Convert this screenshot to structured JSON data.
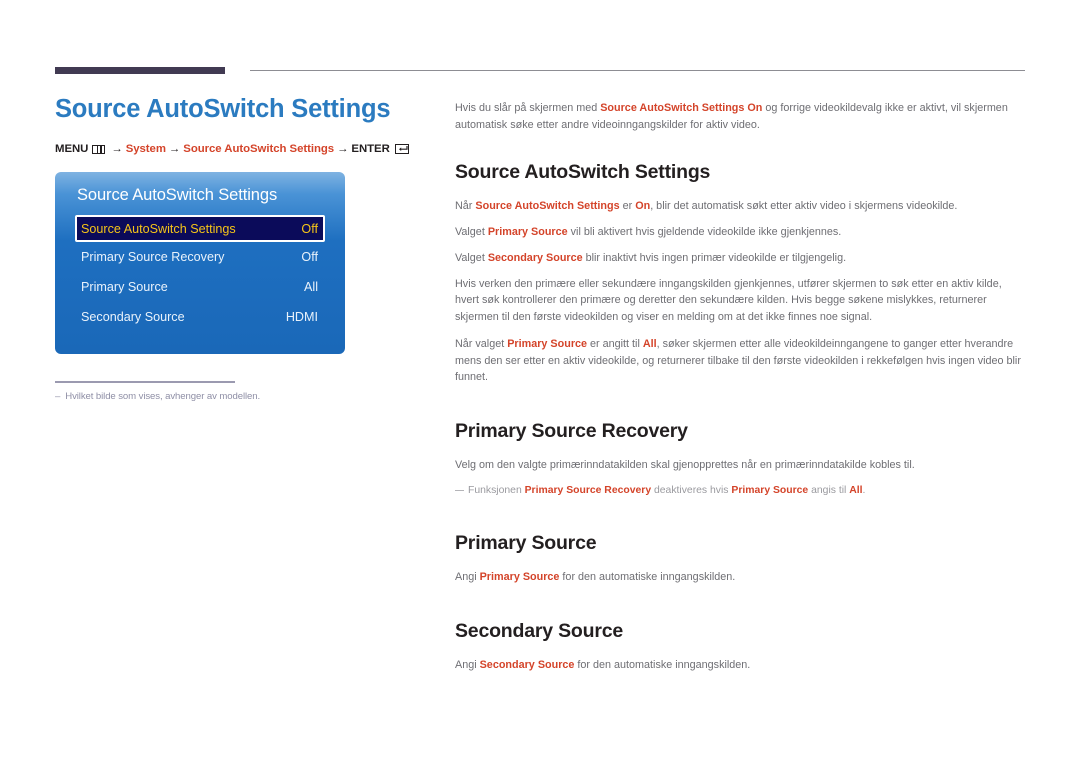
{
  "header": {
    "rule_bar_color": "#413a52",
    "rule_line_color": "#8d8d93"
  },
  "left": {
    "page_title": "Source AutoSwitch Settings",
    "menu_path": {
      "menu_label": "MENU",
      "menu_icon": "menu-grid-icon",
      "arrow": "→",
      "step1": "System",
      "step2": "Source AutoSwitch Settings",
      "enter_label": "ENTER",
      "enter_icon": "enter-return-icon"
    },
    "osd": {
      "title": "Source AutoSwitch Settings",
      "rows": [
        {
          "label": "Source AutoSwitch Settings",
          "value": "Off",
          "selected": true
        },
        {
          "label": "Primary Source Recovery",
          "value": "Off",
          "selected": false
        },
        {
          "label": "Primary Source",
          "value": "All",
          "selected": false
        },
        {
          "label": "Secondary Source",
          "value": "HDMI",
          "selected": false
        }
      ],
      "selected_bg": "#0b0b5a",
      "selected_text": "#f5c518",
      "panel_blue": "#1e6fc0"
    },
    "footnote": {
      "dash": "–",
      "text": "Hvilket bilde som vises, avhenger av modellen."
    }
  },
  "right": {
    "intro": {
      "part1": "Hvis du slår på skjermen med ",
      "hl1": "Source AutoSwitch Settings On",
      "part2": " og forrige videokildevalg ikke er aktivt, vil skjermen automatisk søke etter andre videoinngangskilder for aktiv video."
    },
    "sections": [
      {
        "title": "Source AutoSwitch Settings",
        "paras": [
          {
            "p1": "Når ",
            "h1": "Source AutoSwitch Settings",
            "p2": " er ",
            "h2": "On",
            "p3": ", blir det automatisk søkt etter aktiv video i skjermens videokilde."
          },
          {
            "p1": "Valget ",
            "h1": "Primary Source",
            "p2": " vil bli aktivert hvis gjeldende videokilde ikke gjenkjennes.",
            "h2": "",
            "p3": ""
          },
          {
            "p1": "Valget ",
            "h1": "Secondary Source",
            "p2": " blir inaktivt hvis ingen primær videokilde er tilgjengelig.",
            "h2": "",
            "p3": ""
          },
          {
            "p1": "Hvis verken den primære eller sekundære inngangskilden gjenkjennes, utfører skjermen to søk etter en aktiv kilde, hvert søk kontrollerer den primære og deretter den sekundære kilden. Hvis begge søkene mislykkes, returnerer skjermen til den første videokilden og viser en melding om at det ikke finnes noe signal.",
            "h1": "",
            "p2": "",
            "h2": "",
            "p3": ""
          },
          {
            "p1": "Når valget ",
            "h1": "Primary Source",
            "p2": " er angitt til ",
            "h2": "All",
            "p3": ", søker skjermen etter alle videokildeinngangene to ganger etter hverandre mens den ser etter en aktiv videokilde, og returnerer tilbake til den første videokilden i rekkefølgen hvis ingen video blir funnet."
          }
        ],
        "note": null
      },
      {
        "title": "Primary Source Recovery",
        "paras": [
          {
            "p1": "Velg om den valgte primærinndatakilden skal gjenopprettes når en primærinndatakilde kobles til.",
            "h1": "",
            "p2": "",
            "h2": "",
            "p3": ""
          }
        ],
        "note": {
          "n1": "Funksjonen ",
          "h1": "Primary Source Recovery",
          "n2": " deaktiveres hvis ",
          "h2": "Primary Source",
          "n3": " angis til ",
          "h3": "All",
          "n4": "."
        }
      },
      {
        "title": "Primary Source",
        "paras": [
          {
            "p1": "Angi ",
            "h1": "Primary Source",
            "p2": " for den automatiske inngangskilden.",
            "h2": "",
            "p3": ""
          }
        ],
        "note": null
      },
      {
        "title": "Secondary Source",
        "paras": [
          {
            "p1": "Angi ",
            "h1": "Secondary Source",
            "p2": " for den automatiske inngangskilden.",
            "h2": "",
            "p3": ""
          }
        ],
        "note": null
      }
    ]
  },
  "colors": {
    "accent_orange": "#d4442a",
    "title_blue": "#2b7bc0",
    "body_gray": "#6e6e73"
  }
}
